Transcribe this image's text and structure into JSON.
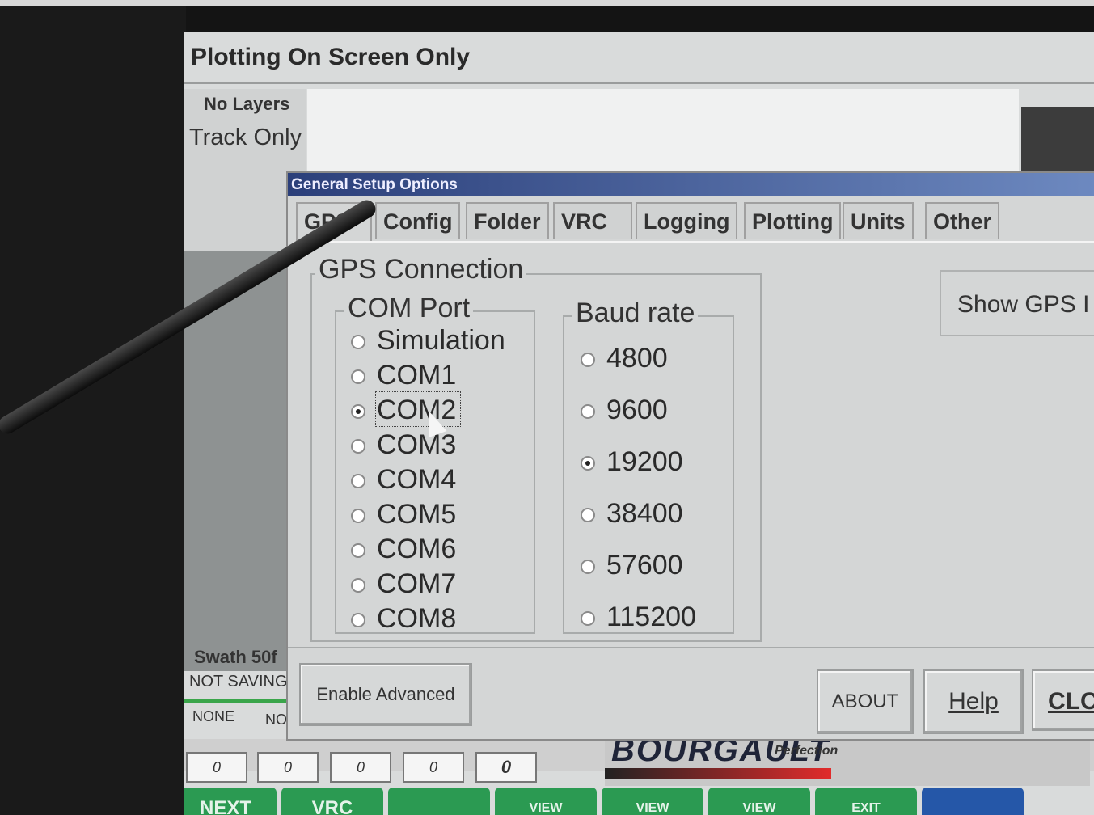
{
  "app": {
    "title": "Plotting On Screen Only",
    "layers": "No Layers",
    "track": "Track Only",
    "swath": "Swath 50f",
    "saving": "NOT SAVING",
    "cells": [
      "NONE",
      "NO"
    ],
    "counters": [
      "0",
      "0",
      "0",
      "0",
      "0"
    ],
    "logo": "BOURGAULT",
    "logo_sub": "Perfection",
    "nav": [
      "NEXT",
      "VRC",
      "",
      "VIEW",
      "VIEW",
      "VIEW",
      "EXIT",
      ""
    ]
  },
  "dialog": {
    "title": "General Setup Options",
    "tabs": [
      "GPS",
      "Config",
      "Folder",
      "VRC",
      "Logging",
      "Plotting",
      "Units",
      "Other"
    ],
    "active_tab": "GPS",
    "gps_group": "GPS Connection",
    "com_group": "COM Port",
    "com_options": [
      "Simulation",
      "COM1",
      "COM2",
      "COM3",
      "COM4",
      "COM5",
      "COM6",
      "COM7",
      "COM8"
    ],
    "com_selected": "COM2",
    "baud_group": "Baud rate",
    "baud_options": [
      "4800",
      "9600",
      "19200",
      "38400",
      "57600",
      "115200"
    ],
    "baud_selected": "19200",
    "show_gps_label": "Show GPS I",
    "enable_advanced": "Enable Advanced",
    "about": "ABOUT",
    "help": "Help",
    "close": "CLC"
  },
  "colors": {
    "screen_bg": "#d9dbdb",
    "titlebar": "#2b3f7a",
    "nav_green": "#2b9a52",
    "nav_blue": "#2557a8"
  }
}
